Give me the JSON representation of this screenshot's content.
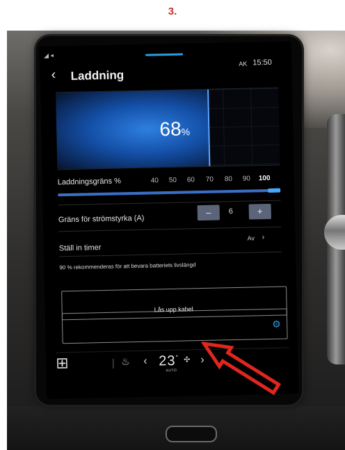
{
  "step_label": "3.",
  "screen": {
    "status": {
      "signal": "◢ ◂",
      "ak": "AK",
      "time": "15:50"
    },
    "header": {
      "back_icon": "chevron-left-icon",
      "title": "Laddning"
    },
    "battery": {
      "level_fraction": 0.68,
      "percent_value": "68",
      "percent_unit": "%"
    },
    "charge_limit": {
      "label": "Laddningsgräns %",
      "scale": [
        "40",
        "50",
        "60",
        "70",
        "80",
        "90",
        "100"
      ],
      "selected": "100",
      "fraction": 1.0
    },
    "current_limit": {
      "label": "Gräns för strömstyrka (A)",
      "minus": "–",
      "value": "6",
      "plus": "+"
    },
    "timer": {
      "label": "Ställ in timer",
      "value": "Av",
      "chevron": "›"
    },
    "recommendation": "90 % rekommenderas för att bevara batteriets livslängd",
    "unlock_button": "Lås upp kabel",
    "bottom_bar": {
      "apps_icon": "grid-icon",
      "seat_icon": "seat-heat-icon",
      "temp_value": "23",
      "temp_unit": "°",
      "fan_icon": "fan-icon",
      "auto": "AUTO"
    }
  },
  "annotation": {
    "arrow_color": "#e0261f"
  },
  "colors": {
    "accent": "#2a9fe0",
    "step": "#c9302c"
  }
}
